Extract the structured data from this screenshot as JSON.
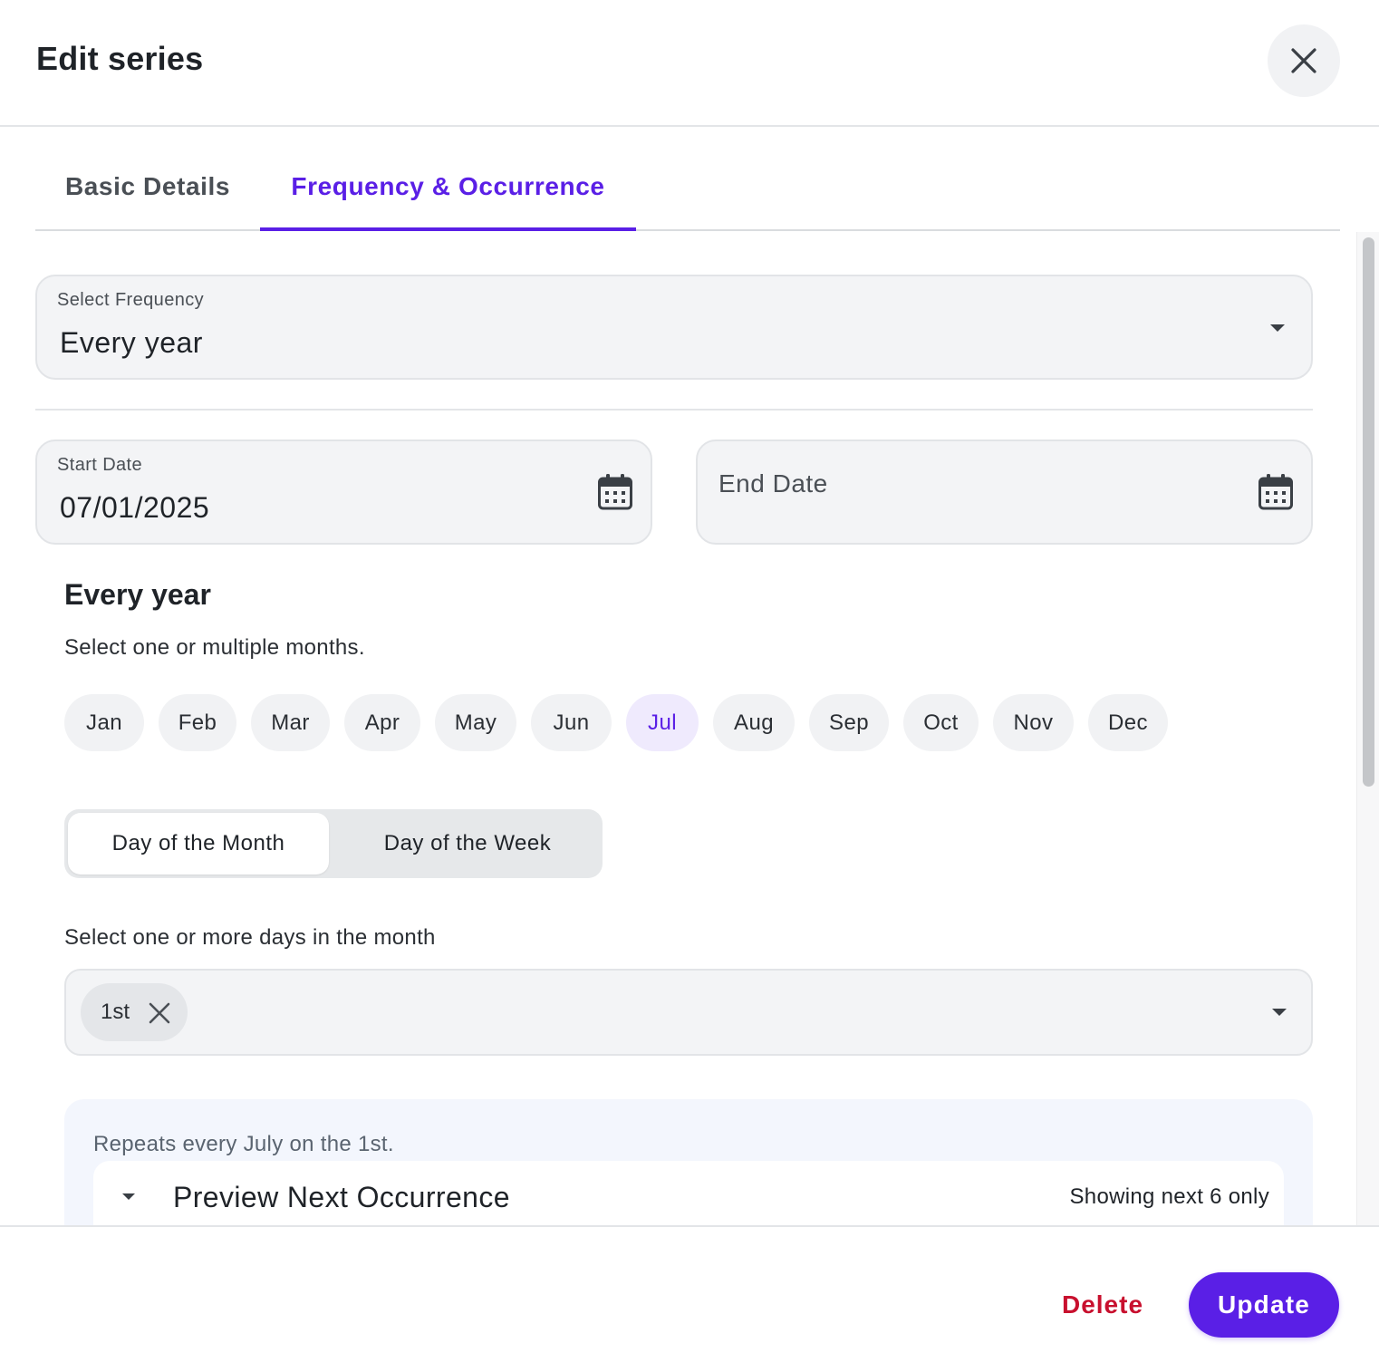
{
  "dialog": {
    "title": "Edit series",
    "close_icon": "close-icon"
  },
  "tabs": [
    {
      "label": "Basic Details",
      "active": false
    },
    {
      "label": "Frequency & Occurrence",
      "active": true
    }
  ],
  "frequency": {
    "label": "Select Frequency",
    "value": "Every year",
    "icon": "chevron-down-icon"
  },
  "start_date": {
    "label": "Start Date",
    "value": "07/01/2025",
    "icon": "calendar-icon"
  },
  "end_date": {
    "placeholder": "End Date",
    "icon": "calendar-icon"
  },
  "section": {
    "title": "Every year",
    "months_helper": "Select one or multiple months."
  },
  "months": [
    {
      "label": "Jan",
      "selected": false
    },
    {
      "label": "Feb",
      "selected": false
    },
    {
      "label": "Mar",
      "selected": false
    },
    {
      "label": "Apr",
      "selected": false
    },
    {
      "label": "May",
      "selected": false
    },
    {
      "label": "Jun",
      "selected": false
    },
    {
      "label": "Jul",
      "selected": true
    },
    {
      "label": "Aug",
      "selected": false
    },
    {
      "label": "Sep",
      "selected": false
    },
    {
      "label": "Oct",
      "selected": false
    },
    {
      "label": "Nov",
      "selected": false
    },
    {
      "label": "Dec",
      "selected": false
    }
  ],
  "day_mode": {
    "options": [
      "Day of the Month",
      "Day of the Week"
    ],
    "selected": "Day of the Month"
  },
  "days": {
    "helper": "Select one or more days in the month",
    "chips": [
      "1st"
    ],
    "icon": "chevron-down-icon"
  },
  "summary": {
    "text": "Repeats every July on the 1st.",
    "preview_title": "Preview Next Occurrence",
    "preview_note": "Showing next 6 only"
  },
  "footer": {
    "delete_label": "Delete",
    "update_label": "Update"
  },
  "colors": {
    "accent": "#5a1fe6",
    "danger": "#c8102e",
    "field_bg": "#f3f4f6",
    "selected_month_bg": "#efeafd"
  }
}
